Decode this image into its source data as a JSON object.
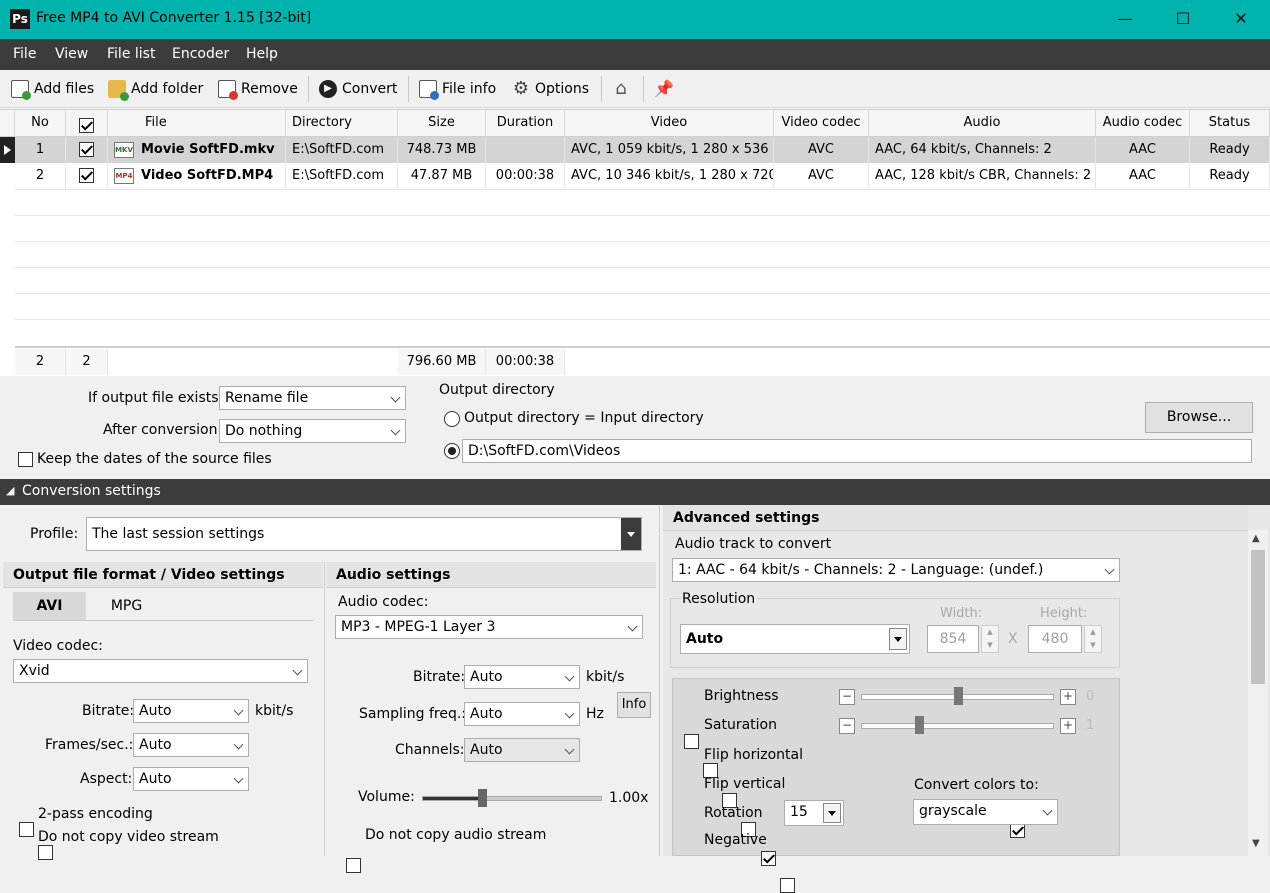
{
  "window": {
    "title": "Free MP4 to AVI Converter 1.15  [32-bit]",
    "app_icon": "Ps",
    "minimize": "—",
    "maximize": "☐",
    "close": "✕"
  },
  "menu": [
    "File",
    "View",
    "File list",
    "Encoder",
    "Help"
  ],
  "toolbar": {
    "add_files": "Add files",
    "add_folder": "Add folder",
    "remove": "Remove",
    "convert": "Convert",
    "file_info": "File info",
    "options": "Options"
  },
  "grid": {
    "headers": [
      "No",
      "",
      "File",
      "Directory",
      "Size",
      "Duration",
      "Video",
      "Video codec",
      "Audio",
      "Audio codec",
      "Status"
    ],
    "rows": [
      {
        "no": "1",
        "icon": "MKV",
        "file": "Movie SoftFD.mkv",
        "dir": "E:\\SoftFD.com",
        "size": "748.73 MB",
        "duration": "",
        "video": "AVC, 1 059 kbit/s, 1 280 x 536",
        "vcodec": "AVC",
        "audio": "AAC, 64 kbit/s, Channels: 2",
        "acodec": "AAC",
        "status": "Ready"
      },
      {
        "no": "2",
        "icon": "MP4",
        "file": "Video SoftFD.MP4",
        "dir": "E:\\SoftFD.com",
        "size": "47.87 MB",
        "duration": "00:00:38",
        "video": "AVC, 10 346 kbit/s, 1 280 x 720",
        "vcodec": "AVC",
        "audio": "AAC, 128 kbit/s CBR, Channels: 2",
        "acodec": "AAC",
        "status": "Ready"
      }
    ],
    "footer": {
      "count": "2",
      "checked": "2",
      "size": "796.60 MB",
      "duration": "00:00:38"
    }
  },
  "output": {
    "if_exists_label": "If output file exists:",
    "if_exists_value": "Rename file",
    "after_label": "After conversion:",
    "after_value": "Do nothing",
    "keep_dates": "Keep the dates of the source files",
    "dir_title": "Output directory",
    "dir_same": "Output directory = Input directory",
    "dir_path": "D:\\SoftFD.com\\Videos",
    "browse": "Browse..."
  },
  "conversion_header": "Conversion settings",
  "profile": {
    "label": "Profile:",
    "value": "The last session settings"
  },
  "video": {
    "section": "Output file format / Video settings",
    "tab_avi": "AVI",
    "tab_mpg": "MPG",
    "codec_label": "Video codec:",
    "codec_value": "Xvid",
    "bitrate_label": "Bitrate:",
    "bitrate_value": "Auto",
    "bitrate_unit": "kbit/s",
    "fps_label": "Frames/sec.:",
    "fps_value": "Auto",
    "aspect_label": "Aspect:",
    "aspect_value": "Auto",
    "twopass": "2-pass encoding",
    "nocopy": "Do not copy video stream"
  },
  "audio": {
    "section": "Audio settings",
    "codec_label": "Audio codec:",
    "codec_value": "MP3 - MPEG-1 Layer 3",
    "bitrate_label": "Bitrate:",
    "bitrate_value": "Auto",
    "bitrate_unit": "kbit/s",
    "info": "Info",
    "freq_label": "Sampling freq.:",
    "freq_value": "Auto",
    "freq_unit": "Hz",
    "channels_label": "Channels:",
    "channels_value": "Auto",
    "volume_label": "Volume:",
    "volume_value": "1.00x",
    "volume_level": 0.33,
    "nocopy": "Do not copy audio stream"
  },
  "advanced": {
    "section": "Advanced settings",
    "track_label": "Audio track to convert",
    "track_value": "1: AAC - 64 kbit/s - Channels: 2 - Language: (undef.)",
    "resolution_label": "Resolution",
    "resolution_value": "Auto",
    "width_label": "Width:",
    "width_value": "854",
    "height_label": "Height:",
    "height_value": "480",
    "x": "X",
    "brightness": "Brightness",
    "brightness_value": "0",
    "brightness_level": 0.5,
    "saturation": "Saturation",
    "saturation_value": "1",
    "saturation_level": 0.3,
    "flip_h": "Flip horizontal",
    "flip_v": "Flip vertical",
    "rotation": "Rotation",
    "rotation_value": "15",
    "negative": "Negative",
    "convert_colors": "Convert colors to:",
    "colors_value": "grayscale"
  }
}
